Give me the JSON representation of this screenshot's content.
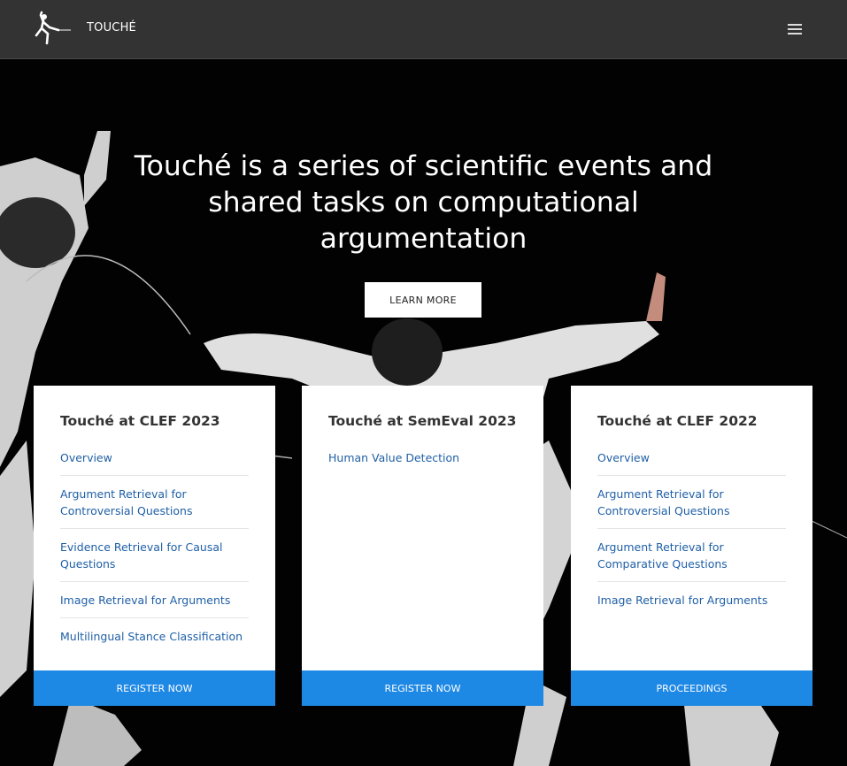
{
  "nav": {
    "brand": "TOUCHÉ",
    "logo_icon": "fencer-logo-icon",
    "menu_icon": "hamburger-menu-icon"
  },
  "hero": {
    "headline": "Touché is a series of scientific events and shared tasks on computational argumentation",
    "cta_label": "LEARN MORE"
  },
  "cards": [
    {
      "title": "Touché at CLEF 2023",
      "links": [
        "Overview",
        "Argument Retrieval for Controversial Questions",
        "Evidence Retrieval for Causal Questions",
        "Image Retrieval for Arguments",
        "Multilingual Stance Classification"
      ],
      "button": "REGISTER NOW"
    },
    {
      "title": "Touché at SemEval 2023",
      "links": [
        "Human Value Detection"
      ],
      "button": "REGISTER NOW"
    },
    {
      "title": "Touché at CLEF 2022",
      "links": [
        "Overview",
        "Argument Retrieval for Controversial Questions",
        "Argument Retrieval for Comparative Questions",
        "Image Retrieval for Arguments"
      ],
      "button": "PROCEEDINGS"
    }
  ],
  "colors": {
    "navbar": "#333333",
    "link": "#1f5fa6",
    "button": "#1e88e5"
  }
}
